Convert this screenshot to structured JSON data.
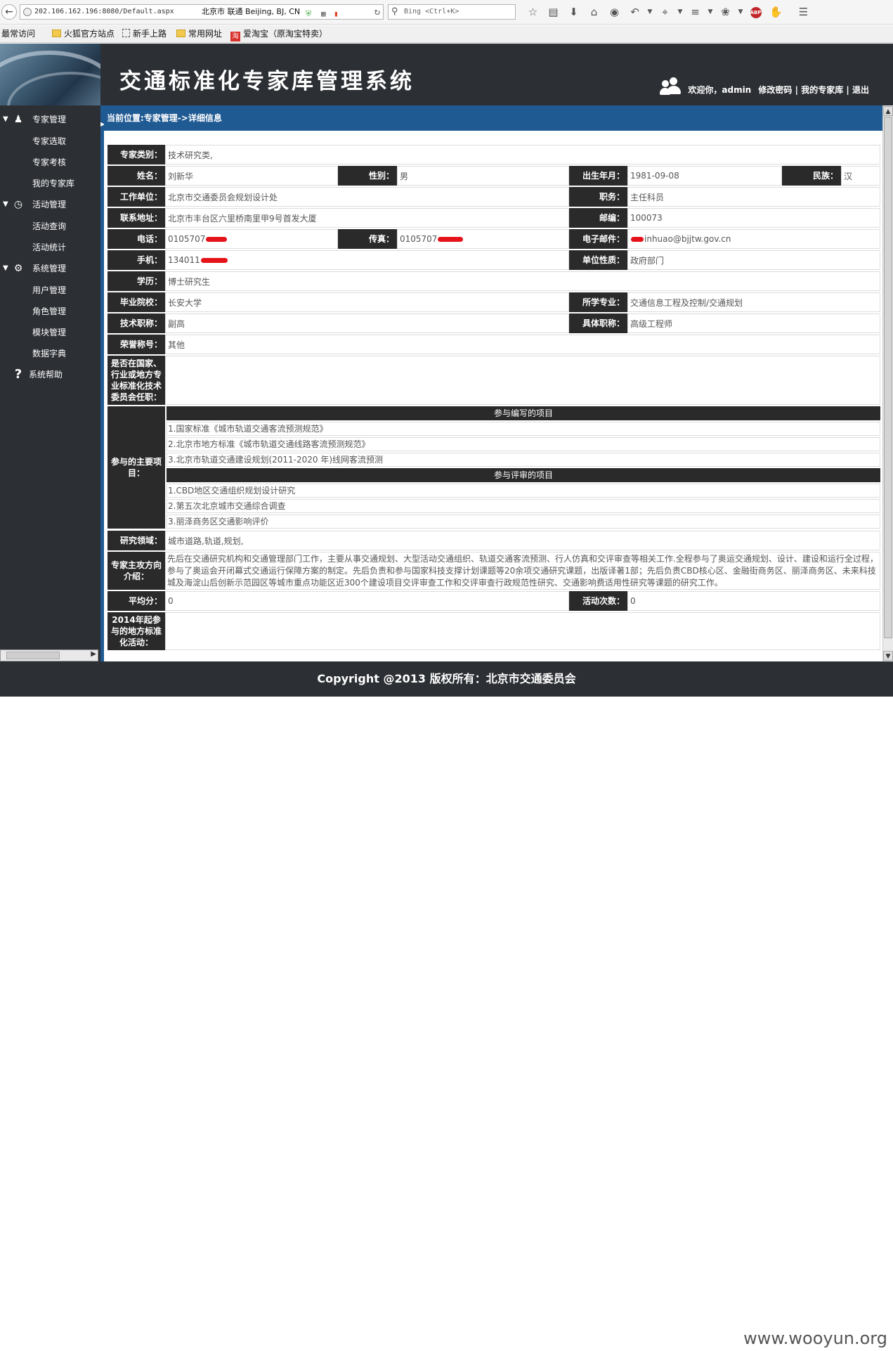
{
  "browser": {
    "url": "202.106.162.196:8080/Default.aspx",
    "location": "北京市 联通 Beijing, BJ, CN",
    "search_placeholder": "Bing <Ctrl+K>",
    "toolbar_icons": [
      "star-icon",
      "reading-list-icon",
      "download-icon",
      "home-icon",
      "chat-icon",
      "undo-icon",
      "crop-icon",
      "translate-icon",
      "bug-icon",
      "adblock-icon",
      "extension-icon",
      "menu-icon"
    ],
    "abp_label": "ABP",
    "bookmarks": [
      "最常访问",
      "火狐官方站点",
      "新手上路",
      "常用网址",
      "爱淘宝（原淘宝特卖）"
    ],
    "taobao_glyph": "淘"
  },
  "header": {
    "title": "交通标准化专家库管理系统",
    "welcome": "欢迎你，admin",
    "links": [
      "修改密码",
      "我的专家库",
      "退出"
    ],
    "separator": "|"
  },
  "sidebar": {
    "groups": [
      {
        "label": "专家管理",
        "icon": "user-icon",
        "items": [
          "专家选取",
          "专家考核",
          "我的专家库"
        ]
      },
      {
        "label": "活动管理",
        "icon": "clock-icon",
        "items": [
          "活动查询",
          "活动统计"
        ]
      },
      {
        "label": "系统管理",
        "icon": "gear-icon",
        "items": [
          "用户管理",
          "角色管理",
          "模块管理",
          "数据字典"
        ]
      },
      {
        "label": "系统帮助",
        "icon": "help-icon",
        "items": []
      }
    ]
  },
  "breadcrumb": "当前位置:专家管理->详细信息",
  "detail": {
    "category": {
      "label": "专家类别：",
      "value": "技术研究类,"
    },
    "name": {
      "label": "姓名：",
      "value": "刘新华"
    },
    "gender": {
      "label": "性别：",
      "value": "男"
    },
    "birth": {
      "label": "出生年月：",
      "value": "1981-09-08"
    },
    "ethnicity": {
      "label": "民族：",
      "value": "汉"
    },
    "employer": {
      "label": "工作单位：",
      "value": "北京市交通委员会规划设计处"
    },
    "position": {
      "label": "职务：",
      "value": "主任科员"
    },
    "address": {
      "label": "联系地址：",
      "value": "北京市丰台区六里桥南里甲9号首发大厦"
    },
    "postcode": {
      "label": "邮编：",
      "value": "100073"
    },
    "phone": {
      "label": "电话：",
      "value": "0105707"
    },
    "fax": {
      "label": "传真：",
      "value": "0105707"
    },
    "email": {
      "label": "电子邮件：",
      "value": "inhuao@bjjtw.gov.cn"
    },
    "mobile": {
      "label": "手机：",
      "value": "134011"
    },
    "unit_type": {
      "label": "单位性质：",
      "value": "政府部门"
    },
    "education": {
      "label": "学历：",
      "value": "博士研究生"
    },
    "school": {
      "label": "毕业院校：",
      "value": "长安大学"
    },
    "major": {
      "label": "所学专业：",
      "value": "交通信息工程及控制/交通规划"
    },
    "tech_title": {
      "label": "技术职称：",
      "value": "副高"
    },
    "specific_title": {
      "label": "具体职称：",
      "value": "高级工程师"
    },
    "honor": {
      "label": "荣誉称号：",
      "value": "其他"
    },
    "committee": {
      "label": "是否在国家、行业或地方专业标准化技术委员会任职：",
      "value": ""
    },
    "projects_label": "参与的主要项目：",
    "compiled_title": "参与编写的项目",
    "compiled": [
      "1.国家标准《城市轨道交通客流预测规范》",
      "2.北京市地方标准《城市轨道交通线路客流预测规范》",
      "3.北京市轨道交通建设规划(2011-2020 年)线网客流预测"
    ],
    "reviewed_title": "参与评审的项目",
    "reviewed": [
      "1.CBD地区交通组织规划设计研究",
      "2.第五次北京城市交通综合调查",
      "3.丽泽商务区交通影响评价"
    ],
    "research": {
      "label": "研究领域：",
      "value": "城市道路,轨道,规划,"
    },
    "intro": {
      "label": "专家主攻方向介绍：",
      "value": "先后在交通研究机构和交通管理部门工作，主要从事交通规划、大型活动交通组织、轨道交通客流预测、行人仿真和交评审查等相关工作.全程参与了奥运交通规划、设计、建设和运行全过程，参与了奥运会开闭幕式交通运行保障方案的制定。先后负责和参与国家科技支撑计划课题等20余项交通研究课题，出版译著1部；先后负责CBD核心区、金融街商务区、丽泽商务区、未来科技城及海淀山后创新示范园区等城市重点功能区近300个建设项目交评审查工作和交评审查行政规范性研究、交通影响费适用性研究等课题的研究工作。"
    },
    "avg_score": {
      "label": "平均分：",
      "value": "0"
    },
    "activity_count": {
      "label": "活动次数：",
      "value": "0"
    },
    "local_std": {
      "label": "2014年起参与的地方标准化活动：",
      "value": ""
    }
  },
  "footer": "Copyright @2013   版权所有：北京市交通委员会",
  "watermark": "www.wooyun.org",
  "colors": {
    "header_bg": "#2c2f34",
    "accent_blue": "#1f5a93",
    "label_bg": "#2b2a2a",
    "redact": "#e5121a"
  }
}
